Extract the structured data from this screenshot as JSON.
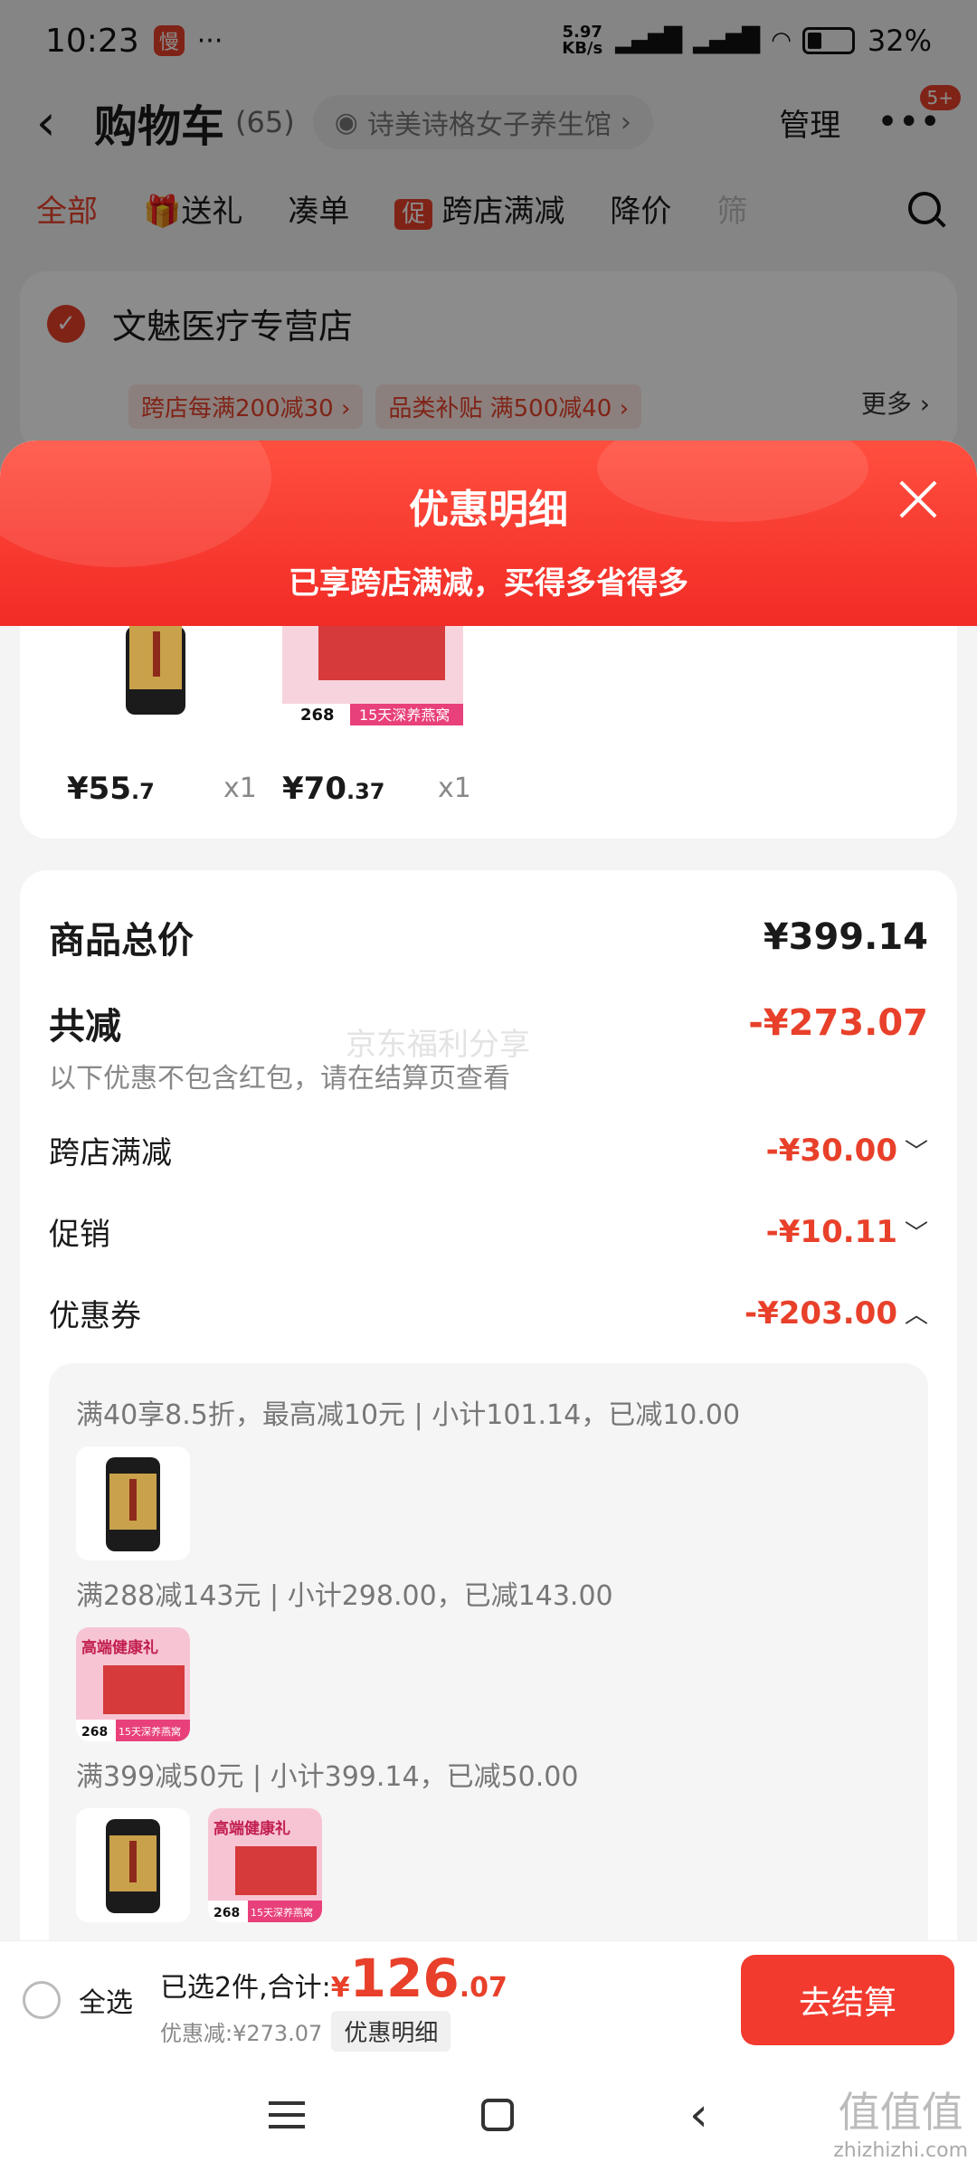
{
  "status": {
    "time": "10:23",
    "app_badge": "慢",
    "dots": "···",
    "speed_top": "5.97",
    "speed_bottom": "KB/s",
    "battery": "32%"
  },
  "header": {
    "title": "购物车",
    "count": "(65)",
    "store_pill": "诗美诗格女子养生馆",
    "manage": "管理",
    "more_badge": "5+"
  },
  "tabs": {
    "all": "全部",
    "gift": "送礼",
    "bundle": "凑单",
    "promo_tag": "促",
    "cross_store": "跨店满减",
    "price_drop": "降价",
    "cut_off": "筛"
  },
  "store": {
    "name": "文魅医疗专营店",
    "promo1": "跨店每满200减30 ›",
    "promo2": "品类补贴 满500减40 ›",
    "more": "更多 ›"
  },
  "modal": {
    "title": "优惠明细",
    "subtitle": "已享跨店满减，买得多省得多"
  },
  "items": [
    {
      "price_int": "¥55",
      "price_dec": ".7",
      "qty": "x1"
    },
    {
      "price_int": "¥70",
      "price_dec": ".37",
      "qty": "x1"
    }
  ],
  "thumb_text": {
    "gift_title": "高端健康礼",
    "gift_badge": "15天深养燕窝",
    "gift_price": "268"
  },
  "detail": {
    "total_label": "商品总价",
    "total_value": "¥399.14",
    "reduce_label": "共减",
    "reduce_value": "-¥273.07",
    "hint": "以下优惠不包含红包，请在结算页查看",
    "watermark": "京东福利分享",
    "cross_label": "跨店满减",
    "cross_value": "-¥30.00",
    "promo_label": "促销",
    "promo_value": "-¥10.11",
    "coupon_label": "优惠券",
    "coupon_value": "-¥203.00"
  },
  "coupons": [
    "满40享8.5折，最高减10元 | 小计101.14，已减10.00",
    "满288减143元 | 小计298.00，已减143.00",
    "满399减50元 | 小计399.14，已减50.00"
  ],
  "bottom": {
    "select_all": "全选",
    "selected": "已选2件,合计:",
    "yen": "¥",
    "int": "126",
    "dec": ".07",
    "discount": "优惠减:¥273.07",
    "detail_btn": "优惠明细",
    "checkout": "去结算"
  },
  "site": {
    "mark": "值值值",
    "url": "zhizhizhi.com"
  },
  "colors": {
    "accent": "#e8402a",
    "checkout": "#f23a2f"
  }
}
